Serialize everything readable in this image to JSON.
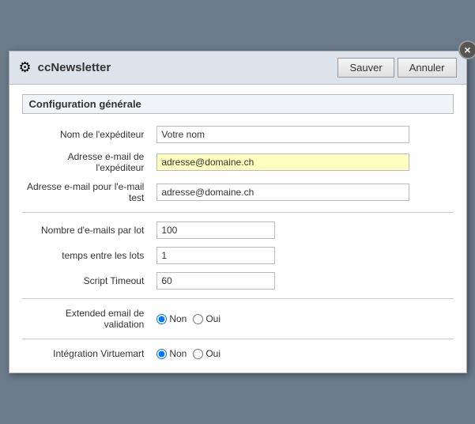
{
  "dialog": {
    "title": "ccNewsletter",
    "close_label": "×",
    "save_label": "Sauver",
    "cancel_label": "Annuler"
  },
  "section": {
    "title": "Configuration générale"
  },
  "fields": {
    "nom_expediteur": {
      "label": "Nom de l'expéditeur",
      "value": "Votre nom",
      "placeholder": "Votre nom"
    },
    "email_expediteur": {
      "label": "Adresse e-mail de l'expéditeur",
      "value": "adresse@domaine.ch",
      "placeholder": "adresse@domaine.ch"
    },
    "email_test": {
      "label": "Adresse e-mail pour l'e-mail test",
      "value": "adresse@domaine.ch",
      "placeholder": "adresse@domaine.ch"
    },
    "emails_par_lot": {
      "label": "Nombre d'e-mails par lot",
      "value": "100"
    },
    "temps_entre_lots": {
      "label": "temps entre les lots",
      "value": "1"
    },
    "script_timeout": {
      "label": "Script Timeout",
      "value": "60"
    },
    "extended_email": {
      "label": "Extended email de validation",
      "non_label": "Non",
      "oui_label": "Oui",
      "selected": "non"
    },
    "integration_virtuemart": {
      "label": "Intégration Virtuemart",
      "non_label": "Non",
      "oui_label": "Oui",
      "selected": "non"
    }
  },
  "icons": {
    "gear": "⚙"
  }
}
